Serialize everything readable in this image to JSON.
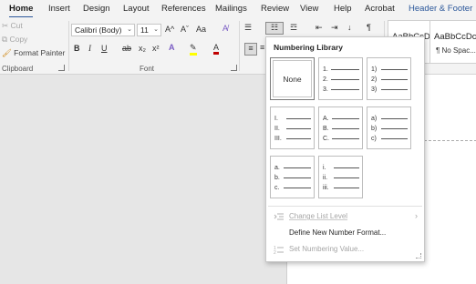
{
  "tabs": [
    {
      "label": "Home",
      "active": true
    },
    {
      "label": "Insert"
    },
    {
      "label": "Design"
    },
    {
      "label": "Layout"
    },
    {
      "label": "References"
    },
    {
      "label": "Mailings"
    },
    {
      "label": "Review"
    },
    {
      "label": "View"
    },
    {
      "label": "Help"
    },
    {
      "label": "Acrobat"
    },
    {
      "label": "Header & Footer",
      "contextual": true
    }
  ],
  "clipboard": {
    "cut": "Cut",
    "copy": "Copy",
    "format_painter": "Format Painter",
    "group_label": "Clipboard"
  },
  "font": {
    "name": "Calibri (Body)",
    "size": "11",
    "group_label": "Font",
    "grow": "A^",
    "shrink": "Aˇ",
    "change_case": "Aa",
    "bold": "B",
    "italic": "I",
    "underline": "U",
    "strike": "ab",
    "subscript": "x₂",
    "superscript": "x²"
  },
  "styles": [
    {
      "sample": "AaBbCcDc",
      "name": ""
    },
    {
      "sample": "AaBbCcDc",
      "name": "¶ No Spac..."
    }
  ],
  "numbering_library": {
    "title": "Numbering Library",
    "none_label": "None",
    "formats": [
      {
        "markers": [
          "1.",
          "2.",
          "3."
        ]
      },
      {
        "markers": [
          "1)",
          "2)",
          "3)"
        ]
      },
      {
        "markers": [
          "I.",
          "II.",
          "III."
        ]
      },
      {
        "markers": [
          "A.",
          "B.",
          "C."
        ]
      },
      {
        "markers": [
          "a)",
          "b)",
          "c)"
        ]
      },
      {
        "markers": [
          "a.",
          "b.",
          "c."
        ]
      },
      {
        "markers": [
          "i.",
          "ii.",
          "iii."
        ]
      }
    ]
  },
  "menu": {
    "change_list_level": "Change List Level",
    "define_new_number_format": "Define New Number Format...",
    "set_numbering_value": "Set Numbering Value..."
  },
  "colors": {
    "accent": "#2b579a",
    "highlight": "#ffff00",
    "font_color": "#c00000"
  }
}
